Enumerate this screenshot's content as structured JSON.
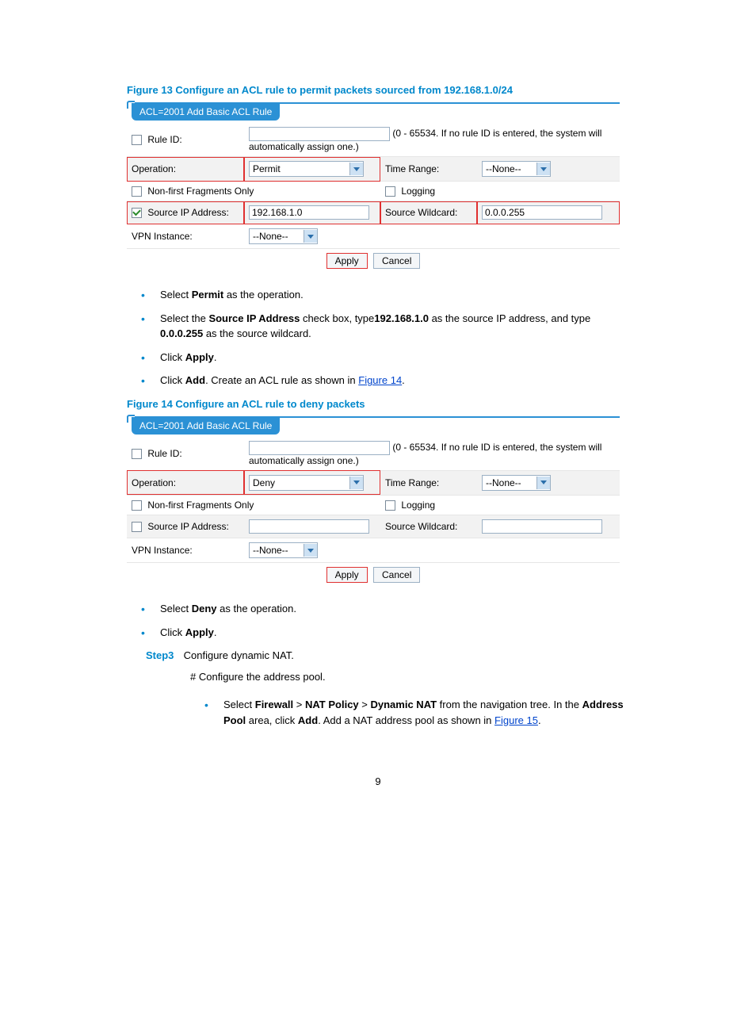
{
  "figure13": {
    "caption": "Figure 13 Configure an ACL rule to permit packets sourced from 192.168.1.0/24",
    "tab": "ACL=2001 Add Basic ACL Rule",
    "rule_id_label": "Rule ID:",
    "rule_hint": "(0 - 65534. If no rule ID is entered, the system will automatically assign one.)",
    "operation_label": "Operation:",
    "operation_value": "Permit",
    "timerange_label": "Time Range:",
    "timerange_value": "--None--",
    "nonfirst_label": "Non-first Fragments Only",
    "logging_label": "Logging",
    "srcip_label": "Source IP Address:",
    "srcip_value": "192.168.1.0",
    "srcwc_label": "Source Wildcard:",
    "srcwc_value": "0.0.0.255",
    "vpn_label": "VPN Instance:",
    "vpn_value": "--None--",
    "apply": "Apply",
    "cancel": "Cancel"
  },
  "list1": {
    "i1_a": "Select ",
    "i1_b": "Permit",
    "i1_c": " as the operation.",
    "i2_a": "Select the ",
    "i2_b": "Source IP Address",
    "i2_c": " check box, type",
    "i2_d": "192.168.1.0",
    "i2_e": " as the source IP address, and type ",
    "i2_f": "0.0.0.255",
    "i2_g": " as the source wildcard.",
    "i3_a": "Click ",
    "i3_b": "Apply",
    "i3_c": ".",
    "i4_a": "Click ",
    "i4_b": "Add",
    "i4_c": ". Create an ACL rule as shown in ",
    "i4_link": "Figure 14",
    "i4_d": "."
  },
  "figure14": {
    "caption": "Figure 14 Configure an ACL rule to deny packets",
    "tab": "ACL=2001 Add Basic ACL Rule",
    "rule_id_label": "Rule ID:",
    "rule_hint": "(0 - 65534. If no rule ID is entered, the system will automatically assign one.)",
    "operation_label": "Operation:",
    "operation_value": "Deny",
    "timerange_label": "Time Range:",
    "timerange_value": "--None--",
    "nonfirst_label": "Non-first Fragments Only",
    "logging_label": "Logging",
    "srcip_label": "Source IP Address:",
    "srcip_value": "",
    "srcwc_label": "Source Wildcard:",
    "srcwc_value": "",
    "vpn_label": "VPN Instance:",
    "vpn_value": "--None--",
    "apply": "Apply",
    "cancel": "Cancel"
  },
  "list2": {
    "i1_a": "Select ",
    "i1_b": "Deny",
    "i1_c": " as the operation.",
    "i2_a": "Click ",
    "i2_b": "Apply",
    "i2_c": "."
  },
  "step3": {
    "label": "Step3",
    "text": "Configure dynamic NAT.",
    "sub": "# Configure the address pool.",
    "b_a": "Select ",
    "b_fw": "Firewall",
    "b_gt1": " > ",
    "b_nat": "NAT Policy",
    "b_gt2": " > ",
    "b_dn": "Dynamic NAT",
    "b_mid": " from the navigation tree. In the ",
    "b_ap": "Address Pool",
    "b_mid2": " area, click ",
    "b_add": "Add",
    "b_end": ". Add a NAT address pool as shown in ",
    "b_link": "Figure 15",
    "b_dot": "."
  },
  "page": "9"
}
